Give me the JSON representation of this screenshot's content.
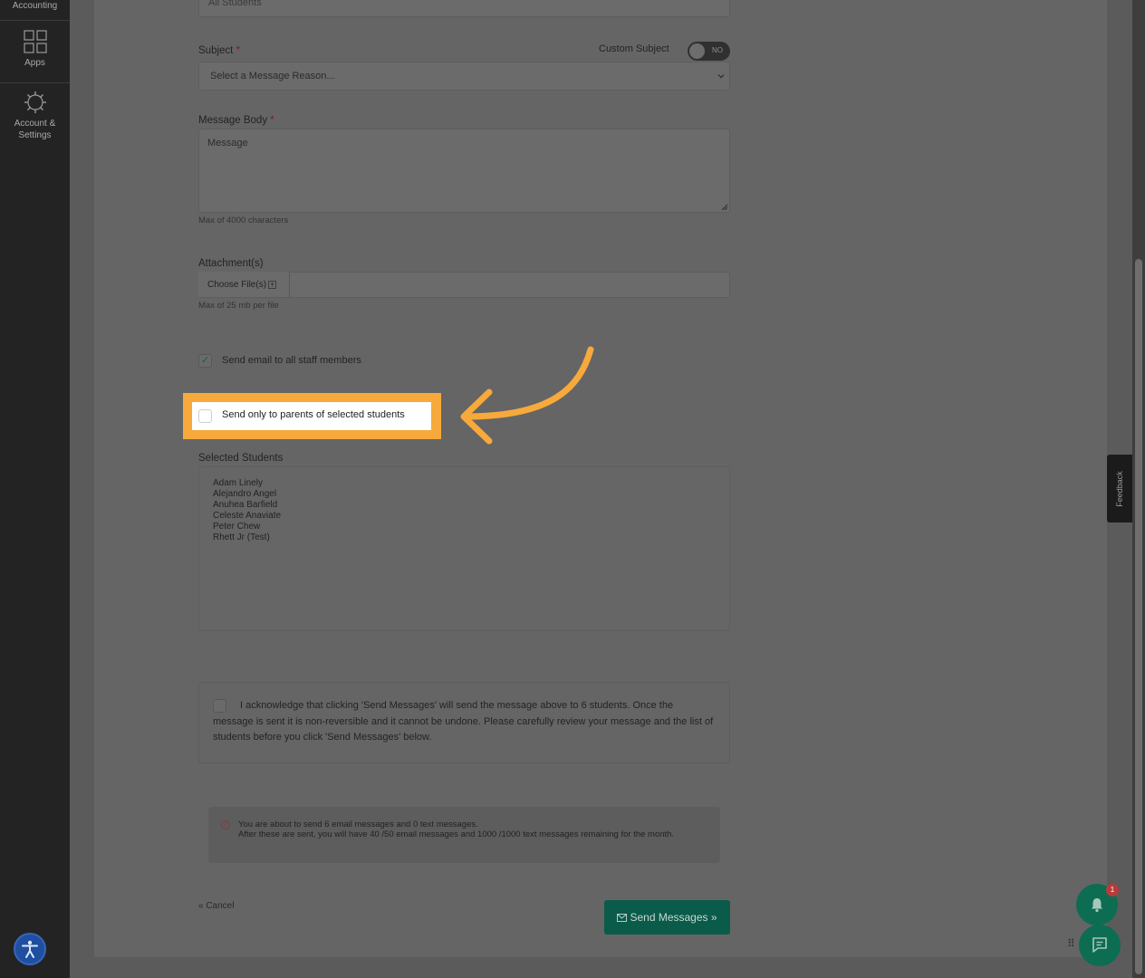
{
  "sidebar": {
    "items": [
      {
        "label": "Accounting",
        "icon": "accounting-icon"
      },
      {
        "label": "Apps",
        "icon": "apps-grid-icon"
      },
      {
        "label_line1": "Account &",
        "label_line2": "Settings",
        "icon": "gear-icon"
      }
    ]
  },
  "form": {
    "recipients_value": "All Students",
    "subject_label": "Subject",
    "required_mark": "*",
    "custom_subject_label": "Custom Subject",
    "custom_subject_toggle": "NO",
    "subject_placeholder": "Select a Message Reason...",
    "body_label": "Message Body",
    "body_placeholder": "Message",
    "body_hint": "Max of 4000 characters",
    "attachments_label": "Attachment(s)",
    "choose_files_label": "Choose File(s)",
    "attachments_hint": "Max of 25 mb per file",
    "staff_checkbox_label": "Send email to all staff members",
    "staff_checkbox_checked": true,
    "parents_checkbox_label": "Send only to parents of selected students",
    "parents_checkbox_checked": false,
    "selected_students_label": "Selected Students",
    "selected_students": [
      "Adam Linely",
      "Alejandro Angel",
      "Anuhea Barfield",
      "Celeste Anaviate",
      "Peter Chew",
      "Rhett Jr (Test)"
    ],
    "acknowledge_text": "I acknowledge that clicking 'Send Messages' will send the message above to 6 students. Once the message is sent it is non-reversible and it cannot be undone. Please carefully review your message and the list of students before you click 'Send Messages' below.",
    "notice_line1": "You are about to send 6 email messages and 0 text messages.",
    "notice_line2": "After these are sent, you will have 40 /50 email messages and 1000 /1000 text messages remaining for the month.",
    "cancel_label": "« Cancel",
    "send_label": "Send Messages »"
  },
  "widgets": {
    "feedback_label": "Feedback",
    "notification_count": "1"
  },
  "colors": {
    "highlight": "#f7a93b",
    "accent_green": "#0c6d52"
  }
}
